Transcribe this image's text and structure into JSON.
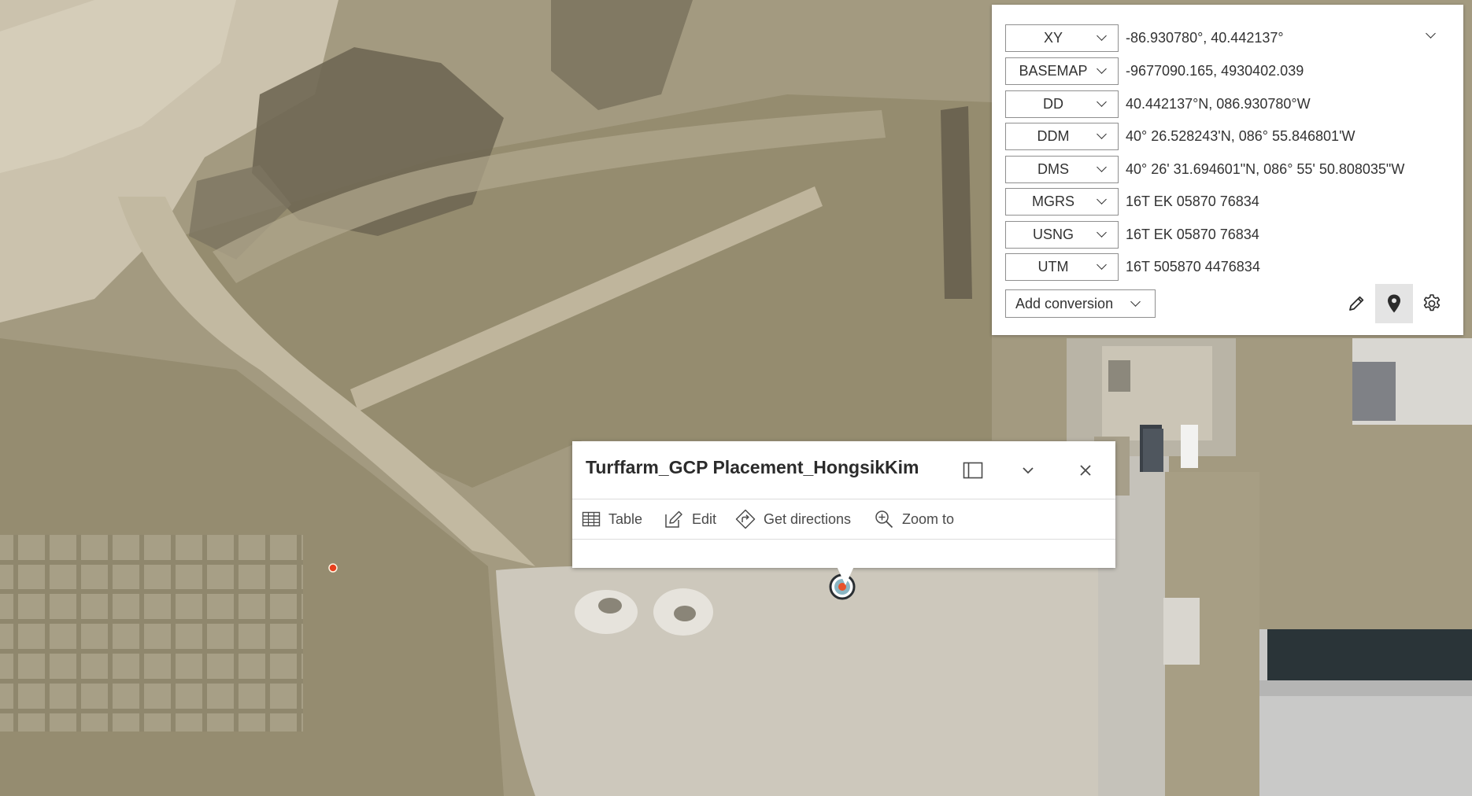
{
  "coordinate_widget": {
    "conversions": [
      {
        "format": "XY",
        "value": "-86.930780°, 40.442137°"
      },
      {
        "format": "BASEMAP",
        "value": "-9677090.165, 4930402.039"
      },
      {
        "format": "DD",
        "value": "40.442137°N, 086.930780°W"
      },
      {
        "format": "DDM",
        "value": "40° 26.528243'N, 086° 55.846801'W"
      },
      {
        "format": "DMS",
        "value": "40° 26' 31.694601\"N, 086° 55' 50.808035\"W"
      },
      {
        "format": "MGRS",
        "value": "16T EK 05870 76834"
      },
      {
        "format": "USNG",
        "value": "16T EK 05870 76834"
      },
      {
        "format": "UTM",
        "value": "16T 505870 4476834"
      }
    ],
    "add_conversion_label": "Add conversion",
    "tools": [
      "pencil-icon",
      "map-pin-icon",
      "gear-icon"
    ]
  },
  "popup": {
    "title": "Turffarm_GCP Placement_HongsikKim",
    "actions": [
      {
        "icon": "table-icon",
        "label": "Table"
      },
      {
        "icon": "edit-icon",
        "label": "Edit"
      },
      {
        "icon": "directions-icon",
        "label": "Get directions"
      },
      {
        "icon": "zoom-to-icon",
        "label": "Zoom to"
      }
    ]
  },
  "colors": {
    "marker_ring": "#2a2f33",
    "marker_fill": "#e8512a",
    "gcp_point": "#e8401e",
    "active_tool_bg": "#e4e4e4"
  }
}
